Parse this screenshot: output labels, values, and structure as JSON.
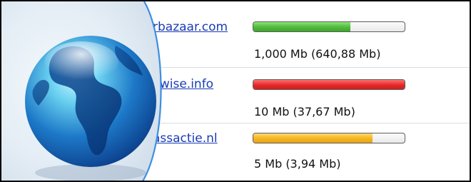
{
  "sites": [
    {
      "domain": "rbazaar.com",
      "usage_text": "1,000 Mb (640,88 Mb)",
      "usage_fraction": 0.64,
      "bar_color": "#4fba3c"
    },
    {
      "domain": "kwise.info",
      "usage_text": "10 Mb (37,67 Mb)",
      "usage_fraction": 1.0,
      "bar_color": "#e62929"
    },
    {
      "domain": "assactie.nl",
      "usage_text": "5 Mb (3,94 Mb)",
      "usage_fraction": 0.79,
      "bar_color": "#f5b520"
    }
  ],
  "icons": {
    "globe": "globe-icon"
  }
}
